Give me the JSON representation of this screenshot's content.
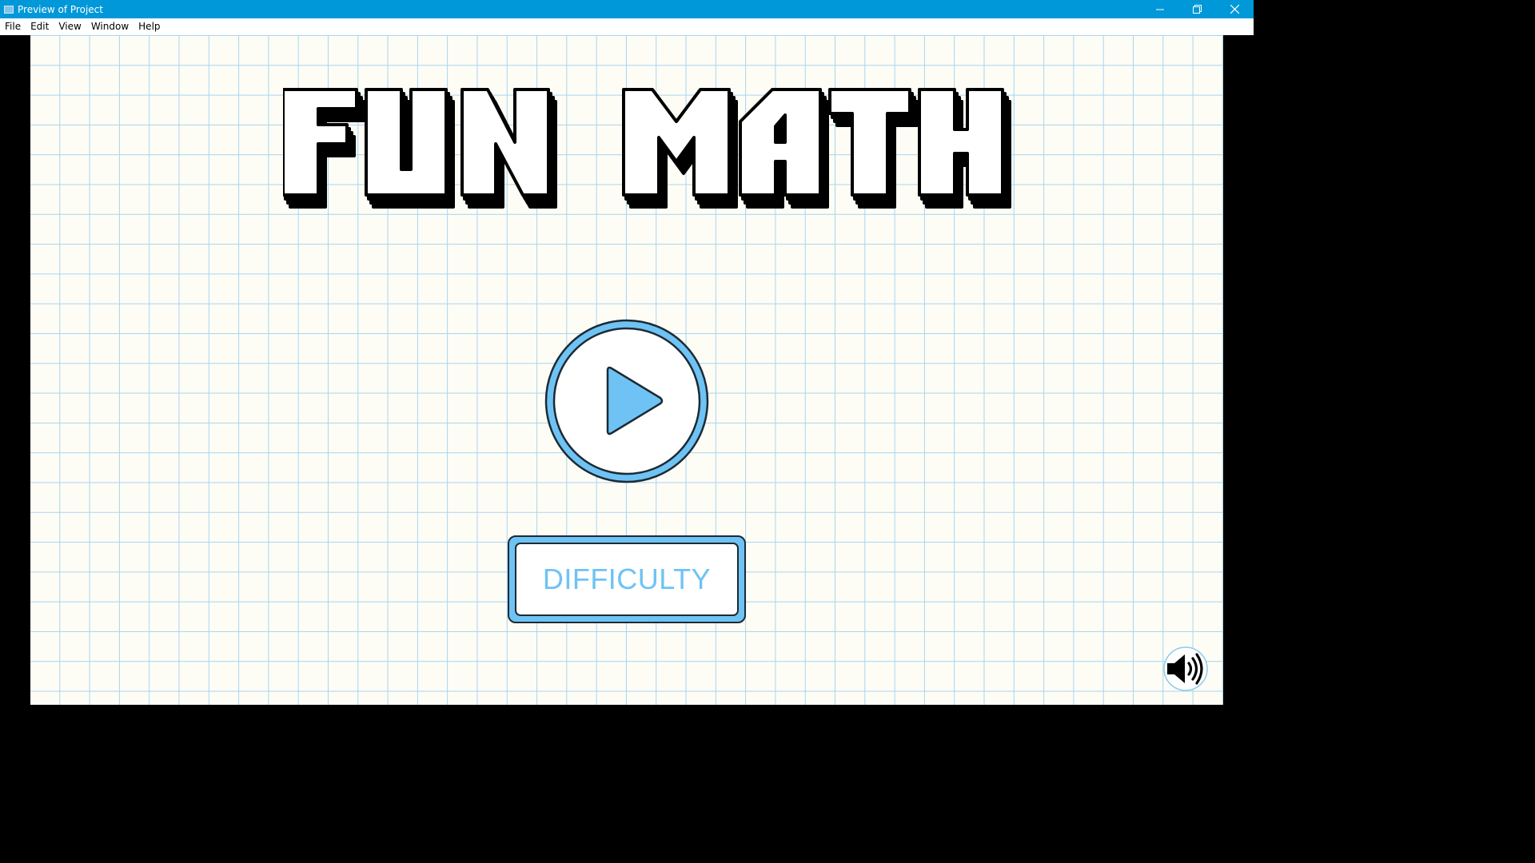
{
  "window": {
    "title": "Preview of Project",
    "controls": [
      "minimize-icon",
      "restore-icon",
      "close-icon"
    ]
  },
  "menu": {
    "items": [
      "File",
      "Edit",
      "View",
      "Window",
      "Help"
    ]
  },
  "game": {
    "logo_text": "FUN MATH",
    "play_icon": "play-icon",
    "difficulty_label": "DIFFICULTY",
    "sound_icon": "speaker-volume-icon"
  },
  "colors": {
    "titlebar": "#0098d8",
    "accent_blue": "#6ec3f4",
    "grid_line": "#a9d4ee",
    "paper": "#fdfdf6",
    "outline": "#1c2a33"
  }
}
